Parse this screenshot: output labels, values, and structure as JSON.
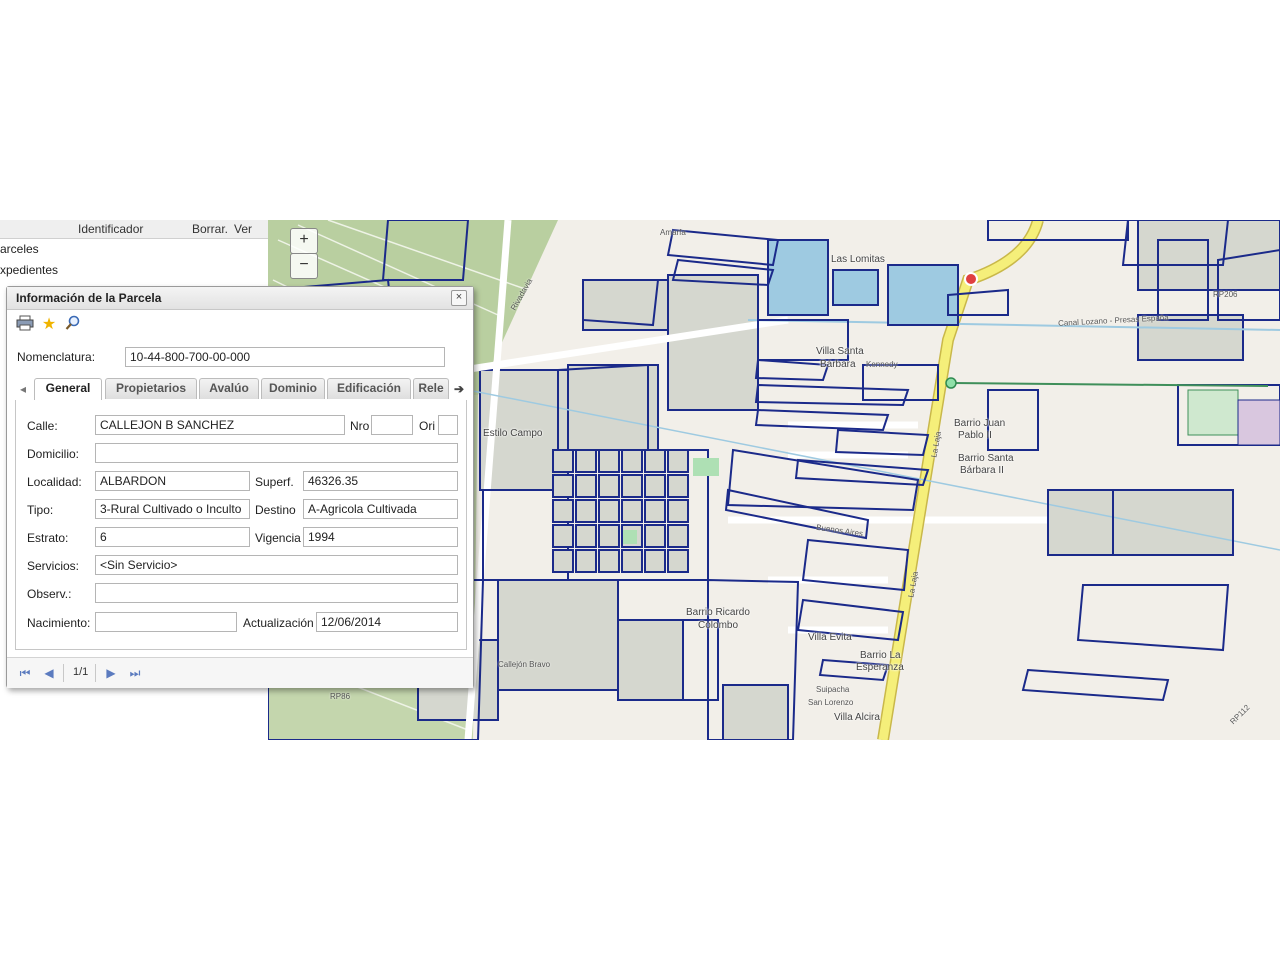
{
  "left_panel": {
    "columns": [
      "Identificador",
      "Borrar.",
      "Ver"
    ],
    "tree": [
      "arceles",
      "xpedientes"
    ]
  },
  "map": {
    "zoom_in": "+",
    "zoom_out": "−",
    "place_labels": [
      {
        "text": "Las Lomitas",
        "name": "label-las-lomitas"
      },
      {
        "text": "Villa Santa",
        "name": "label-villa-santa"
      },
      {
        "text": "Bárbara",
        "name": "label-barbara"
      },
      {
        "text": "Estilo Campo",
        "name": "label-estilo-campo"
      },
      {
        "text": "Barrio Juan",
        "name": "label-barrio-juan"
      },
      {
        "text": "Pablo II",
        "name": "label-pablo-ii"
      },
      {
        "text": "Barrio Santa",
        "name": "label-barrio-santa"
      },
      {
        "text": "Bárbara II",
        "name": "label-barbara-ii"
      },
      {
        "text": "Barrio Ricardo",
        "name": "label-barrio-ricardo"
      },
      {
        "text": "Colombo",
        "name": "label-colombo"
      },
      {
        "text": "Villa Evita",
        "name": "label-villa-evita"
      },
      {
        "text": "Barrio La",
        "name": "label-barrio-la"
      },
      {
        "text": "Esperanza",
        "name": "label-esperanza"
      },
      {
        "text": "Villa Alcira",
        "name": "label-villa-alcira"
      }
    ],
    "street_labels": [
      {
        "text": "Amarfa",
        "name": "street-amarfa"
      },
      {
        "text": "Kennedy",
        "name": "street-kennedy"
      },
      {
        "text": "La Laja",
        "name": "street-la-laja-1"
      },
      {
        "text": "La Laja",
        "name": "street-la-laja-2"
      },
      {
        "text": "Buenos Aires",
        "name": "street-buenos-aires"
      },
      {
        "text": "Suipacha",
        "name": "street-suipacha"
      },
      {
        "text": "San Lorenzo",
        "name": "street-san-lorenzo"
      },
      {
        "text": "Canal Lozano - Presas España",
        "name": "street-canal-lozano"
      },
      {
        "text": "RP206",
        "name": "street-rp206"
      },
      {
        "text": "Rivadavia",
        "name": "street-rivadavia"
      },
      {
        "text": "Callejón Bravo",
        "name": "street-callejon-bravo"
      },
      {
        "text": "RP86",
        "name": "street-rp86"
      },
      {
        "text": "RP112",
        "name": "street-rp112"
      }
    ]
  },
  "dialog": {
    "title": "Información de la Parcela",
    "close": "×",
    "nomenclatura_label": "Nomenclatura:",
    "nomenclatura_value": "10-44-800-700-00-000",
    "tabs": [
      "General",
      "Propietarios",
      "Avalúo",
      "Dominio",
      "Edificación",
      "Rele"
    ],
    "fields": {
      "calle_label": "Calle:",
      "calle": "CALLEJON B SANCHEZ",
      "nro_label": "Nro",
      "nro": "",
      "ori_label": "Ori",
      "ori": "",
      "domicilio_label": "Domicilio:",
      "domicilio": "",
      "localidad_label": "Localidad:",
      "localidad": "ALBARDON",
      "superf_label": "Superf.",
      "superf": "46326.35",
      "tipo_label": "Tipo:",
      "tipo": "3-Rural Cultivado o Inculto",
      "destino_label": "Destino",
      "destino": "A-Agricola Cultivada",
      "estrato_label": "Estrato:",
      "estrato": "6",
      "vigencia_label": "Vigencia",
      "vigencia": "1994",
      "servicios_label": "Servicios:",
      "servicios": "<Sin Servicio>",
      "observ_label": "Observ.:",
      "observ": "",
      "nacimiento_label": "Nacimiento:",
      "nacimiento": "",
      "actualizacion_label": "Actualización",
      "actualizacion": "12/06/2014"
    },
    "pager": "1/1"
  },
  "colors": {
    "parcel_stroke": "#1b2a8a",
    "farmland": "#b9cfa0",
    "field": "#d5d7cf",
    "road_major": "#f5ef7a",
    "water": "#9ecae1"
  }
}
